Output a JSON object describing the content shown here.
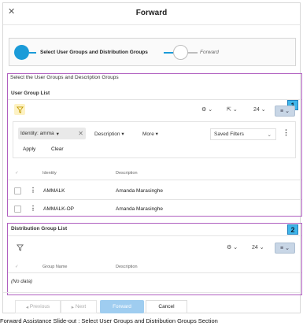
{
  "window": {
    "title": "Forward",
    "close_icon": "close-icon"
  },
  "stepper": {
    "steps": [
      {
        "label": "Select User Groups and Distribution Groups",
        "state": "active"
      },
      {
        "label": "Forward",
        "state": "pending"
      }
    ],
    "accent": "#1b9bd8"
  },
  "section_caption": "Select the User Groups and Description Groups",
  "annotations": [
    "1",
    "2"
  ],
  "user_group_list": {
    "title": "User Group List",
    "toolbar": {
      "page_size": "24"
    },
    "filter": {
      "chip": "Identity: amma",
      "description": "Description",
      "more": "More",
      "saved_filters": "Saved Filters",
      "apply": "Apply",
      "clear": "Clear"
    },
    "columns": [
      "Identity",
      "Description"
    ],
    "rows": [
      {
        "identity": "AMMALK",
        "description": "Amanda Marasinghe"
      },
      {
        "identity": "AMMALK-OP",
        "description": "Amanda Marasinghe"
      }
    ]
  },
  "distribution_group_list": {
    "title": "Distribution Group List",
    "toolbar": {
      "page_size": "24"
    },
    "columns": [
      "Group Name",
      "Description"
    ],
    "empty_text": "(No data)"
  },
  "footer": {
    "previous": "Previous",
    "next": "Next",
    "forward": "Forward",
    "cancel": "Cancel"
  },
  "caption": "Forward Assistance Slide-out : Select User Groups and Distribution Groups Section"
}
